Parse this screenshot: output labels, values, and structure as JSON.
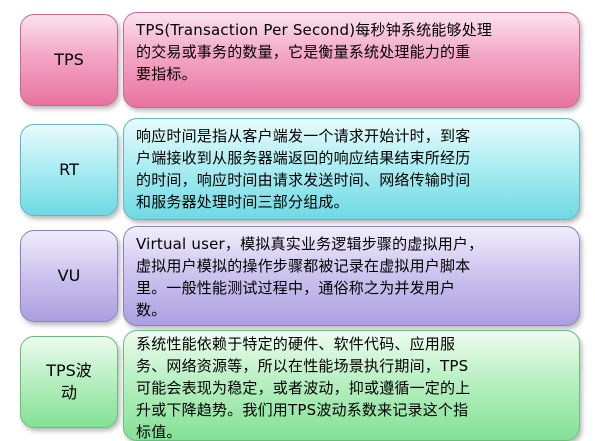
{
  "rows": [
    {
      "label": "TPS",
      "lines": [
        "TPS(Transaction Per Second)每秒钟系统能够处理",
        "的交易或事务的数量，它是衡量系统处理能力的重",
        "要指标。"
      ]
    },
    {
      "label": "RT",
      "lines": [
        "响应时间是指从客户端发一个请求开始计时，到客",
        "户端接收到从服务器端返回的响应结果结束所经历",
        "的时间，响应时间由请求发送时间、网络传输时间",
        "和服务器处理时间三部分组成。"
      ]
    },
    {
      "label": "VU",
      "lines": [
        "Virtual user，模拟真实业务逻辑步骤的虚拟用户，",
        "虚拟用户模拟的操作步骤都被记录在虚拟用户脚本",
        "里。一般性能测试过程中，通俗称之为并发用户",
        "数。"
      ]
    },
    {
      "label_lines": [
        "TPS波",
        "动"
      ],
      "lines": [
        "系统性能依赖于特定的硬件、软件代码、应用服",
        "务、网络资源等，所以在性能场景执行期间，TPS",
        "可能会表现为稳定，或者波动，抑或遵循一定的上",
        "升或下降趋势。我们用TPS波动系数来记录这个指",
        "标值。"
      ]
    }
  ],
  "colors": {
    "tps": "#f3a6c5",
    "rt": "#aeeef3",
    "vu": "#cfc6ef",
    "tps_fluctuation": "#b9f0c3"
  }
}
